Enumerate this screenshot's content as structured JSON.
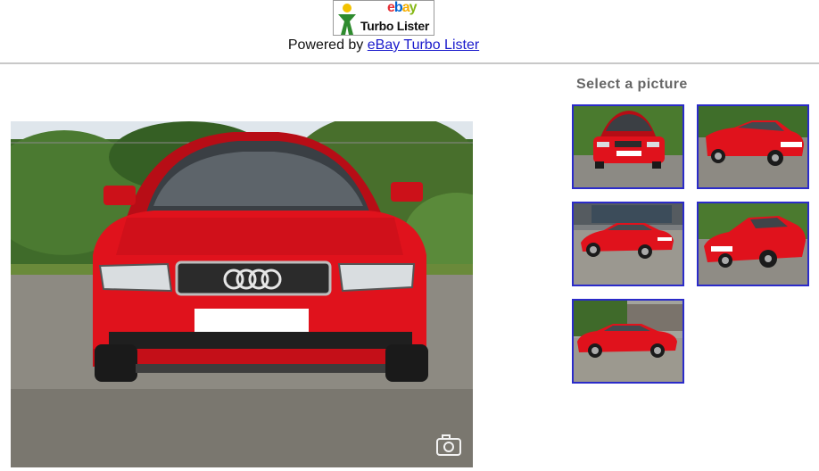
{
  "header": {
    "logo": {
      "brand_letters": [
        "e",
        "b",
        "a",
        "y"
      ],
      "product": "Turbo Lister",
      "colors": {
        "e": "#e53238",
        "b": "#0064d2",
        "a": "#f5af02",
        "y": "#86b817"
      }
    },
    "powered_prefix": "Powered by",
    "powered_link": "eBay Turbo Lister",
    "link_color": "#1a1acc"
  },
  "gallery": {
    "title": "Select a picture",
    "main_photo": {
      "subject": "red-car-front-view",
      "car_color": "#e0121c"
    },
    "thumbnails": [
      {
        "view": "front"
      },
      {
        "view": "front-three-quarter-right"
      },
      {
        "view": "rear-three-quarter-left"
      },
      {
        "view": "front-three-quarter-right-low"
      },
      {
        "view": "side-left"
      }
    ],
    "thumb_border_color": "#2b2bc9"
  }
}
